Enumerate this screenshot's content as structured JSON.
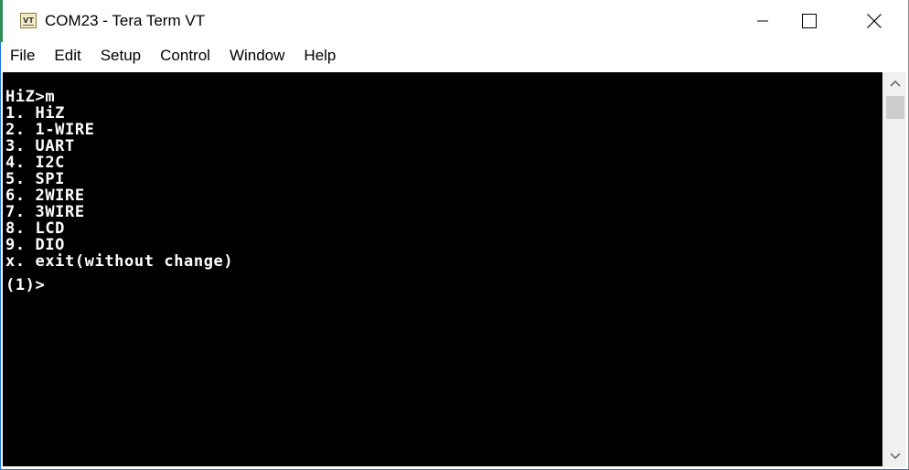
{
  "window": {
    "title": "COM23 - Tera Term VT",
    "icon_label": "VT",
    "icon_name": "vt-app-icon",
    "controls": {
      "minimize": "minimize-icon",
      "maximize": "maximize-icon",
      "close": "close-icon"
    }
  },
  "menu": {
    "items": [
      "File",
      "Edit",
      "Setup",
      "Control",
      "Window",
      "Help"
    ]
  },
  "terminal": {
    "lines": [
      "HiZ>m",
      "1. HiZ",
      "2. 1-WIRE",
      "3. UART",
      "4. I2C",
      "5. SPI",
      "6. 2WIRE",
      "7. 3WIRE",
      "8. LCD",
      "9. DIO",
      "x. exit(without change)"
    ],
    "prompt": "(1)>",
    "background": "#000000",
    "foreground": "#ffffff"
  },
  "scrollbar": {
    "up_icon": "chevron-up-icon",
    "down_icon": "chevron-down-icon"
  }
}
